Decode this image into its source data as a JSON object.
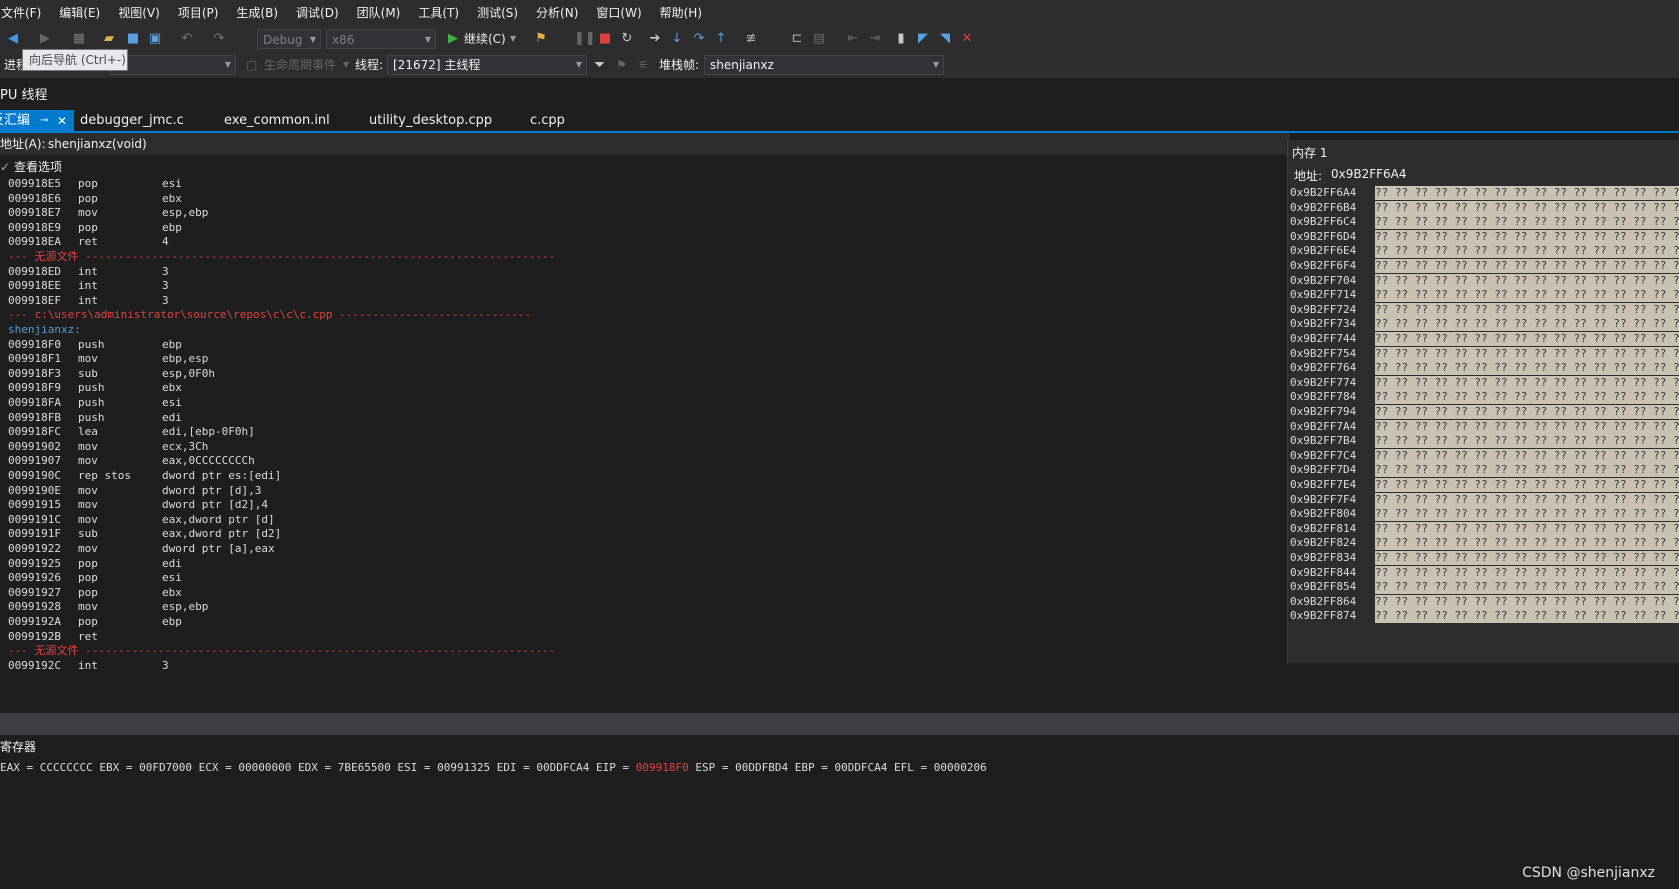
{
  "menu": [
    "文件(F)",
    "编辑(E)",
    "视图(V)",
    "项目(P)",
    "生成(B)",
    "调试(D)",
    "团队(M)",
    "工具(T)",
    "测试(S)",
    "分析(N)",
    "窗口(W)",
    "帮助(H)"
  ],
  "toolbar": {
    "config": "Debug",
    "platform": "x86",
    "continue_label": "继续(C)",
    "tooltip": "向后导航 (Ctrl+-)"
  },
  "location": {
    "process_label": "进程",
    "lifecycle_label": "生命周期事件",
    "thread_label": "线程:",
    "thread_value": "[21672] 主线程",
    "stackframe_label": "堆栈帧:",
    "stackframe_value": "shenjianxz"
  },
  "window_title": "PU 线程",
  "tabs": [
    {
      "label": "反汇编",
      "active": true
    },
    {
      "label": "debugger_jmc.c",
      "active": false
    },
    {
      "label": "exe_common.inl",
      "active": false
    },
    {
      "label": "utility_desktop.cpp",
      "active": false
    },
    {
      "label": "c.cpp",
      "active": false
    }
  ],
  "address": {
    "label": "地址(A):",
    "value": "shenjianxz(void)"
  },
  "view_options": "查看选项",
  "disassembly": [
    {
      "kind": "ins",
      "addr": "009918E5",
      "mn": "pop",
      "op": "esi"
    },
    {
      "kind": "ins",
      "addr": "009918E6",
      "mn": "pop",
      "op": "ebx"
    },
    {
      "kind": "ins",
      "addr": "009918E7",
      "mn": "mov",
      "op": "esp,ebp"
    },
    {
      "kind": "ins",
      "addr": "009918E9",
      "mn": "pop",
      "op": "ebp"
    },
    {
      "kind": "ins",
      "addr": "009918EA",
      "mn": "ret",
      "op": "4"
    },
    {
      "kind": "sep",
      "text": "--- 无源文件 -----------------------------------------------------------------------"
    },
    {
      "kind": "ins",
      "addr": "009918ED",
      "mn": "int",
      "op": "3"
    },
    {
      "kind": "ins",
      "addr": "009918EE",
      "mn": "int",
      "op": "3"
    },
    {
      "kind": "ins",
      "addr": "009918EF",
      "mn": "int",
      "op": "3"
    },
    {
      "kind": "sep",
      "text": "--- c:\\users\\administrator\\source\\repos\\c\\c\\c.cpp -----------------------------"
    },
    {
      "kind": "label",
      "text": "shenjianxz:"
    },
    {
      "kind": "ins",
      "addr": "009918F0",
      "mn": "push",
      "op": "ebp"
    },
    {
      "kind": "ins",
      "addr": "009918F1",
      "mn": "mov",
      "op": "ebp,esp"
    },
    {
      "kind": "ins",
      "addr": "009918F3",
      "mn": "sub",
      "op": "esp,0F0h"
    },
    {
      "kind": "ins",
      "addr": "009918F9",
      "mn": "push",
      "op": "ebx"
    },
    {
      "kind": "ins",
      "addr": "009918FA",
      "mn": "push",
      "op": "esi"
    },
    {
      "kind": "ins",
      "addr": "009918FB",
      "mn": "push",
      "op": "edi"
    },
    {
      "kind": "ins",
      "addr": "009918FC",
      "mn": "lea",
      "op": "edi,[ebp-0F0h]"
    },
    {
      "kind": "ins",
      "addr": "00991902",
      "mn": "mov",
      "op": "ecx,3Ch"
    },
    {
      "kind": "ins",
      "addr": "00991907",
      "mn": "mov",
      "op": "eax,0CCCCCCCCh"
    },
    {
      "kind": "ins",
      "addr": "0099190C",
      "mn": "rep stos",
      "op": "dword ptr es:[edi]"
    },
    {
      "kind": "ins",
      "addr": "0099190E",
      "mn": "mov",
      "op": "dword ptr [d],3"
    },
    {
      "kind": "ins",
      "addr": "00991915",
      "mn": "mov",
      "op": "dword ptr [d2],4"
    },
    {
      "kind": "ins",
      "addr": "0099191C",
      "mn": "mov",
      "op": "eax,dword ptr [d]"
    },
    {
      "kind": "ins",
      "addr": "0099191F",
      "mn": "sub",
      "op": "eax,dword ptr [d2]"
    },
    {
      "kind": "ins",
      "addr": "00991922",
      "mn": "mov",
      "op": "dword ptr [a],eax"
    },
    {
      "kind": "ins",
      "addr": "00991925",
      "mn": "pop",
      "op": "edi"
    },
    {
      "kind": "ins",
      "addr": "00991926",
      "mn": "pop",
      "op": "esi"
    },
    {
      "kind": "ins",
      "addr": "00991927",
      "mn": "pop",
      "op": "ebx"
    },
    {
      "kind": "ins",
      "addr": "00991928",
      "mn": "mov",
      "op": "esp,ebp"
    },
    {
      "kind": "ins",
      "addr": "0099192A",
      "mn": "pop",
      "op": "ebp"
    },
    {
      "kind": "ins",
      "addr": "0099192B",
      "mn": "ret",
      "op": ""
    },
    {
      "kind": "sep",
      "text": "--- 无源文件 -----------------------------------------------------------------------"
    },
    {
      "kind": "ins",
      "addr": "0099192C",
      "mn": "int",
      "op": "3"
    }
  ],
  "memory": {
    "title": "内存 1",
    "address_label": "地址:",
    "address_value": "0x9B2FF6A4",
    "row_bytes": "?? ?? ?? ?? ?? ?? ?? ?? ?? ?? ?? ?? ?? ?? ?? ??",
    "rows": [
      "0x9B2FF6A4",
      "0x9B2FF6B4",
      "0x9B2FF6C4",
      "0x9B2FF6D4",
      "0x9B2FF6E4",
      "0x9B2FF6F4",
      "0x9B2FF704",
      "0x9B2FF714",
      "0x9B2FF724",
      "0x9B2FF734",
      "0x9B2FF744",
      "0x9B2FF754",
      "0x9B2FF764",
      "0x9B2FF774",
      "0x9B2FF784",
      "0x9B2FF794",
      "0x9B2FF7A4",
      "0x9B2FF7B4",
      "0x9B2FF7C4",
      "0x9B2FF7D4",
      "0x9B2FF7E4",
      "0x9B2FF7F4",
      "0x9B2FF804",
      "0x9B2FF814",
      "0x9B2FF824",
      "0x9B2FF834",
      "0x9B2FF844",
      "0x9B2FF854",
      "0x9B2FF864",
      "0x9B2FF874"
    ]
  },
  "registers": {
    "title": "寄存器",
    "before_eip": "EAX = CCCCCCCC EBX = 00FD7000 ECX = 00000000 EDX = 7BE65500 ESI = 00991325 EDI = 00DDFCA4 EIP = ",
    "eip": "009918F0",
    "after_eip": " ESP = 00DDFBD4 EBP = 00DDFCA4 EFL = 00000206"
  },
  "watermark": "CSDN @shenjianxz",
  "colors": {
    "accent": "#007acc",
    "separator": "#e04040",
    "label": "#569cd6",
    "memory_bg": "#c9c2b3"
  }
}
